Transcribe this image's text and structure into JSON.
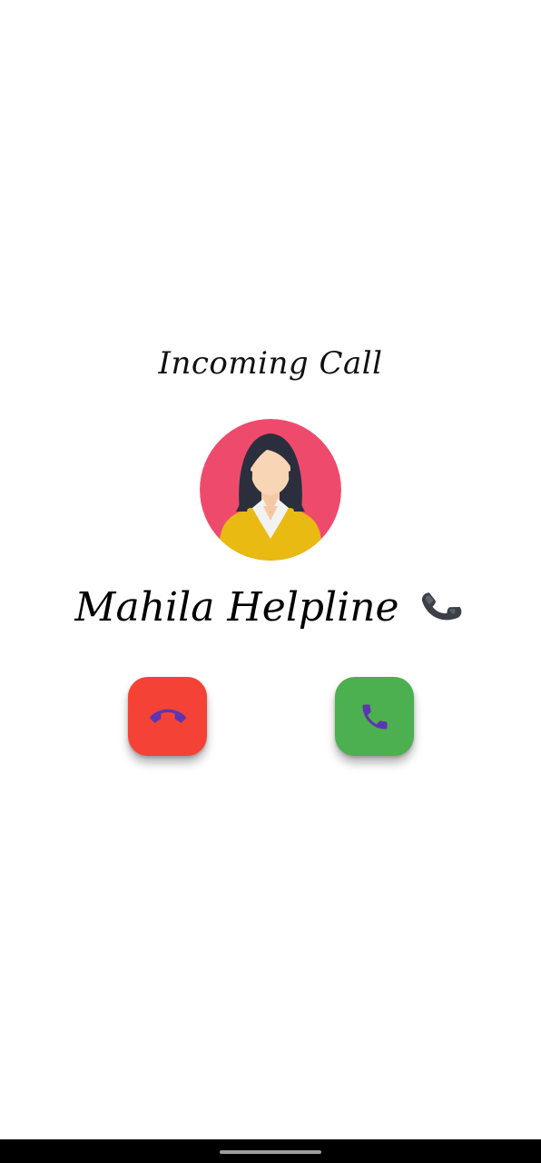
{
  "call": {
    "status_text": "Incoming Call",
    "caller_name": "Mahila Helpline",
    "caller_icon": "telephone-receiver-icon",
    "avatar_icon": "woman-avatar-icon"
  },
  "actions": {
    "decline": {
      "icon": "call-end-icon",
      "color": "#F44336",
      "icon_color": "#5E35B1"
    },
    "accept": {
      "icon": "phone-icon",
      "color": "#4CAF50",
      "icon_color": "#5E35B1"
    }
  },
  "colors": {
    "background": "#FFFFFF",
    "avatar_background": "#EE4B6C",
    "avatar_jacket": "#E8BA12",
    "text": "#000000"
  }
}
